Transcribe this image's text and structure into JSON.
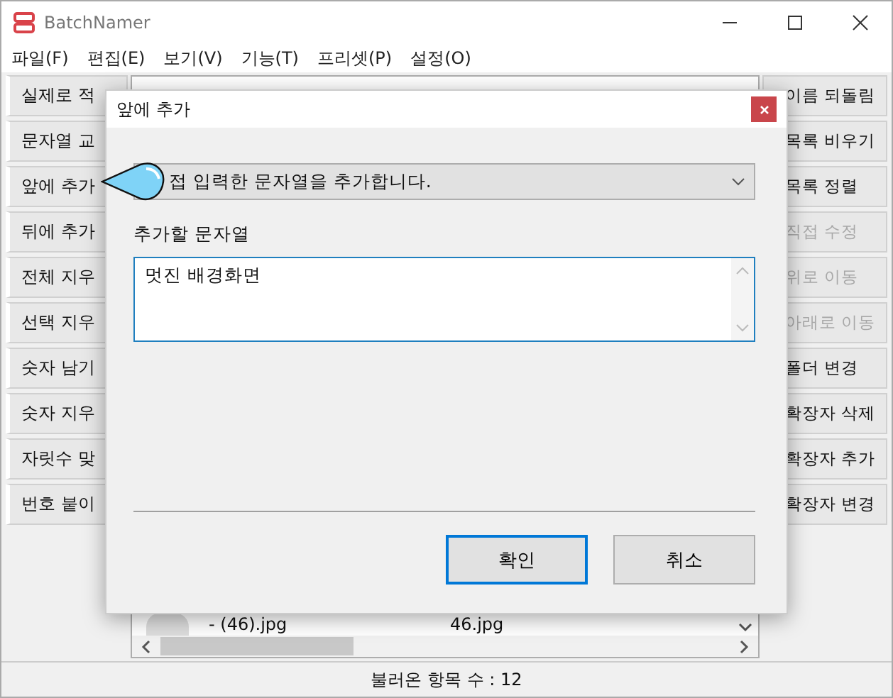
{
  "window": {
    "title": "BatchNamer"
  },
  "menu": [
    {
      "label": "파일(F)"
    },
    {
      "label": "편집(E)"
    },
    {
      "label": "보기(V)"
    },
    {
      "label": "기능(T)"
    },
    {
      "label": "프리셋(P)"
    },
    {
      "label": "설정(O)"
    }
  ],
  "left_buttons": [
    {
      "label": "실제로 적"
    },
    {
      "label": "문자열 교"
    },
    {
      "label": "앞에 추가"
    },
    {
      "label": "뒤에 추가"
    },
    {
      "label": "전체 지우"
    },
    {
      "label": "선택 지우"
    },
    {
      "label": "숫자 남기"
    },
    {
      "label": "숫자 지우"
    },
    {
      "label": "자릿수 맞"
    },
    {
      "label": "번호 붙이"
    }
  ],
  "right_buttons": [
    {
      "label": "이름 되돌림",
      "disabled": false
    },
    {
      "label": "목록 비우기",
      "disabled": false
    },
    {
      "label": "목록 정렬",
      "disabled": false
    },
    {
      "label": "직접 수정",
      "disabled": true
    },
    {
      "label": "위로 이동",
      "disabled": true
    },
    {
      "label": "아래로 이동",
      "disabled": true
    },
    {
      "label": "폴더 변경",
      "disabled": false
    },
    {
      "label": "확장자 삭제",
      "disabled": false
    },
    {
      "label": "확장자 추가",
      "disabled": false
    },
    {
      "label": "확장자 변경",
      "disabled": false
    }
  ],
  "file_list": {
    "rows": [
      {
        "original": "- (46).jpg",
        "new": "46.jpg"
      }
    ]
  },
  "status_bar": "불러온 항목 수 : 12",
  "dialog": {
    "title": "앞에 추가",
    "mode": "접 입력한 문자열을 추가합니다.",
    "field_label": "추가할 문자열",
    "value": "멋진 배경화면",
    "buttons": [
      {
        "label": "확인",
        "selected": true
      },
      {
        "label": "취소",
        "selected": false
      }
    ]
  }
}
